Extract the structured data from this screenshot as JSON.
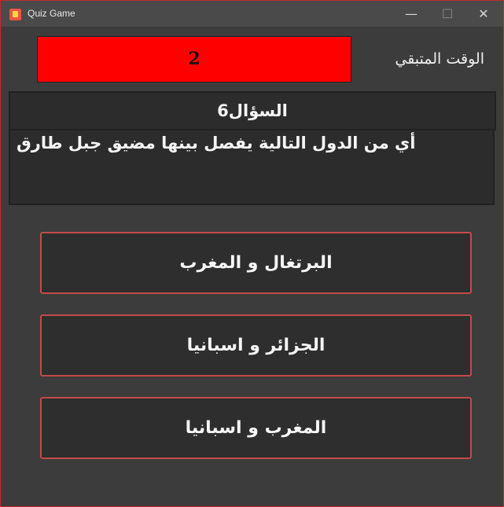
{
  "window": {
    "title": "Quiz Game",
    "controls": {
      "minimize": "—",
      "maximize": "☐",
      "close": "✕"
    }
  },
  "timer": {
    "label": "الوقت المتبقي",
    "value": "2",
    "background_color": "#ff0000"
  },
  "question": {
    "number_label": "السؤال6",
    "text": "أي من الدول التالية يفصل بينها مضيق جبل طارق"
  },
  "answers": [
    {
      "label": "البرتغال و المغرب"
    },
    {
      "label": "الجزائر و اسبانيا"
    },
    {
      "label": "المغرب و اسبانيا"
    }
  ],
  "colors": {
    "background": "#3c3c3c",
    "panel": "#2c2c2c",
    "answer_border": "#c44a4a",
    "window_border": "#c22a2a"
  }
}
